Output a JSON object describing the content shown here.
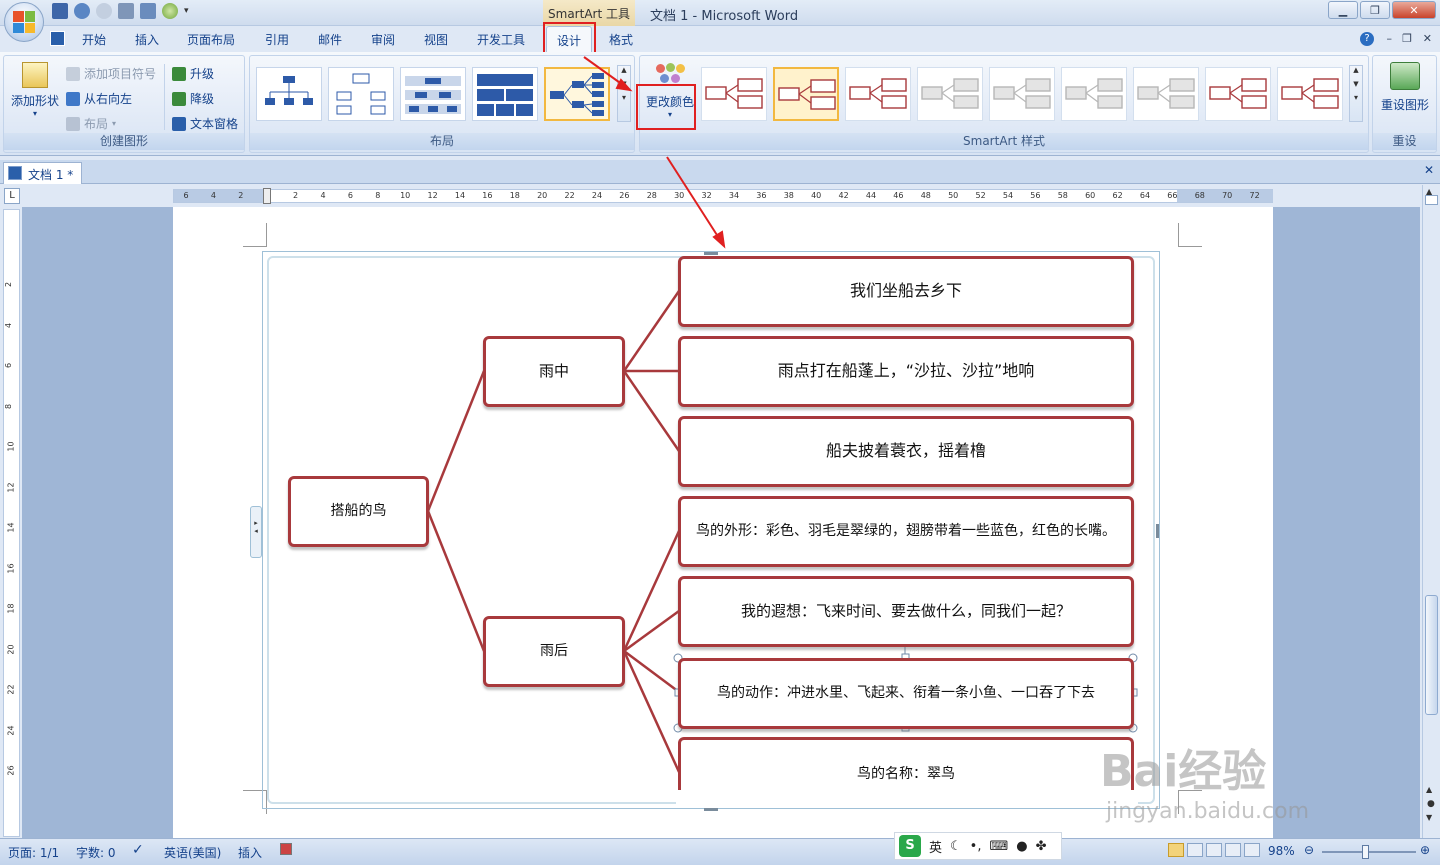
{
  "window": {
    "contextual_tools": "SmartArt 工具",
    "title": "文档 1 - Microsoft Word"
  },
  "ribbon_tabs": [
    "开始",
    "插入",
    "页面布局",
    "引用",
    "邮件",
    "审阅",
    "视图",
    "开发工具",
    "设计",
    "格式"
  ],
  "create_group": {
    "label": "创建图形",
    "add_shape": "添加形状",
    "add_bullet": "添加项目符号",
    "right_to_left": "从右向左",
    "layout": "布局",
    "promote": "升级",
    "demote": "降级",
    "text_pane": "文本窗格"
  },
  "layout_group": {
    "label": "布局"
  },
  "change_colors": "更改颜色",
  "styles_group": {
    "label": "SmartArt 样式"
  },
  "reset_group": {
    "label": "重设",
    "reset_graphic": "重设图形"
  },
  "document_tab": "文档 1 *",
  "ruler_numbers": [
    "6",
    "4",
    "2",
    "2",
    "4",
    "6",
    "8",
    "10",
    "12",
    "14",
    "16",
    "18",
    "20",
    "22",
    "24",
    "26",
    "28",
    "30",
    "32",
    "34",
    "36",
    "38",
    "40",
    "42",
    "44",
    "46",
    "48",
    "50",
    "52",
    "54",
    "56",
    "58",
    "60",
    "62",
    "64",
    "66",
    "68",
    "70",
    "72"
  ],
  "vruler_numbers": [
    "2",
    "4",
    "6",
    "8",
    "10",
    "12",
    "14",
    "16",
    "18",
    "20",
    "22",
    "24",
    "26"
  ],
  "diagram": {
    "root": "搭船的鸟",
    "branch1": "雨中",
    "branch2": "雨后",
    "leaves1": [
      "我们坐船去乡下",
      "雨点打在船蓬上，“沙拉、沙拉”地响",
      "船夫披着蓑衣，摇着橹"
    ],
    "leaves2": [
      "鸟的外形：彩色、羽毛是翠绿的，翅膀带着一些蓝色，红色的长嘴。",
      "我的遐想：飞来时间、要去做什么，同我们一起？",
      "鸟的动作：冲进水里、飞起来、衔着一条小鱼、一口吞了下去",
      "鸟的名称：翠鸟"
    ]
  },
  "colors": {
    "node_border": "#a8393c",
    "connector": "#a8393c",
    "highlight": "#e02020"
  },
  "statusbar": {
    "page": "页面: 1/1",
    "words": "字数: 0",
    "language": "英语(美国)",
    "mode": "插入",
    "zoom": "98%"
  },
  "ime": {
    "logo": "S",
    "lang": "英"
  },
  "watermark": {
    "brand": "Bai经验",
    "url": "jingyan.baidu.com"
  }
}
